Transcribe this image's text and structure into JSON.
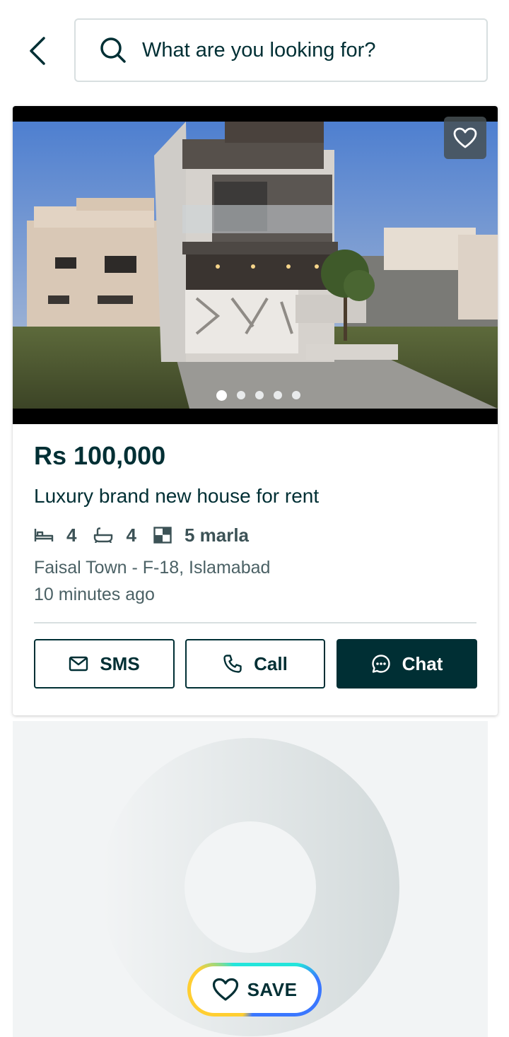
{
  "search": {
    "placeholder": "What are you looking for?"
  },
  "listing": {
    "price": "Rs 100,000",
    "title": "Luxury brand new house for rent",
    "bedrooms": "4",
    "bathrooms": "4",
    "area": "5 marla",
    "location": "Faisal Town - F-18, Islamabad",
    "posted": "10 minutes ago",
    "image_count": 5,
    "active_image": 1
  },
  "actions": {
    "sms_label": "SMS",
    "call_label": "Call",
    "chat_label": "Chat"
  },
  "save_button": {
    "label": "SAVE"
  },
  "icons": {
    "back": "chevron-left-icon",
    "search": "search-icon",
    "favorite": "heart-icon",
    "bed": "bed-icon",
    "bath": "bath-icon",
    "area": "area-icon",
    "sms": "mail-icon",
    "call": "phone-icon",
    "chat": "chat-bubble-icon"
  },
  "colors": {
    "primary": "#002f34",
    "secondary_text": "#4b6165",
    "border": "#d8dfe0",
    "placeholder_bg": "#f2f4f5"
  }
}
